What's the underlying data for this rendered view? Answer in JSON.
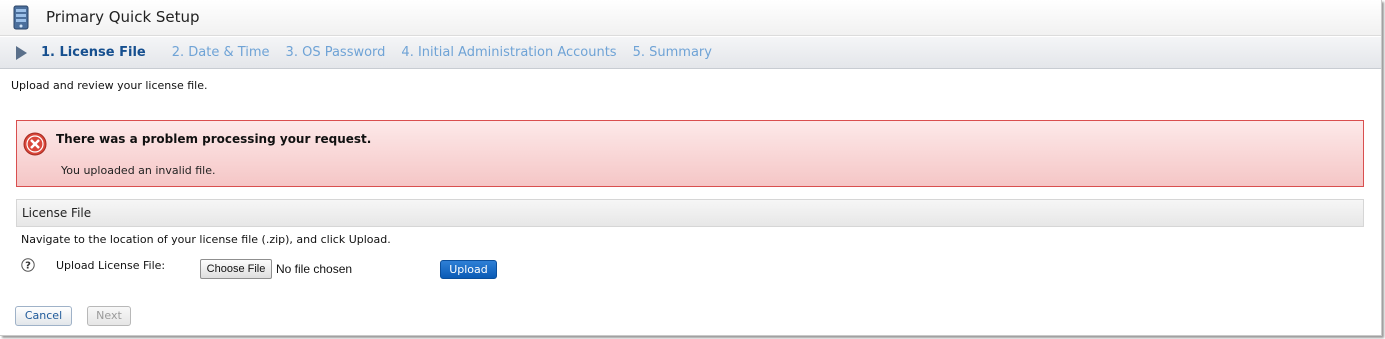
{
  "window": {
    "title": "Primary Quick Setup",
    "icon": "server-icon"
  },
  "steps": [
    {
      "label": "1. License File",
      "active": true
    },
    {
      "label": "2. Date & Time",
      "active": false
    },
    {
      "label": "3. OS Password",
      "active": false
    },
    {
      "label": "4. Initial Administration Accounts",
      "active": false
    },
    {
      "label": "5. Summary",
      "active": false
    }
  ],
  "intro": "Upload and review your license file.",
  "error": {
    "title": "There was a problem processing your request.",
    "message": "You uploaded an invalid file.",
    "icon": "error-icon",
    "color": "#d94f4f"
  },
  "license_section": {
    "header": "License File",
    "description": "Navigate to the location of your license file (.zip), and click Upload.",
    "upload_label": "Upload License File:",
    "choose_file_label": "Choose File",
    "file_status": "No file chosen",
    "upload_button": "Upload"
  },
  "footer": {
    "cancel_label": "Cancel",
    "next_label": "Next"
  },
  "colors": {
    "accent": "#0a5bb5",
    "active_step": "#164f8f",
    "inactive_step": "#6fa3d6"
  }
}
